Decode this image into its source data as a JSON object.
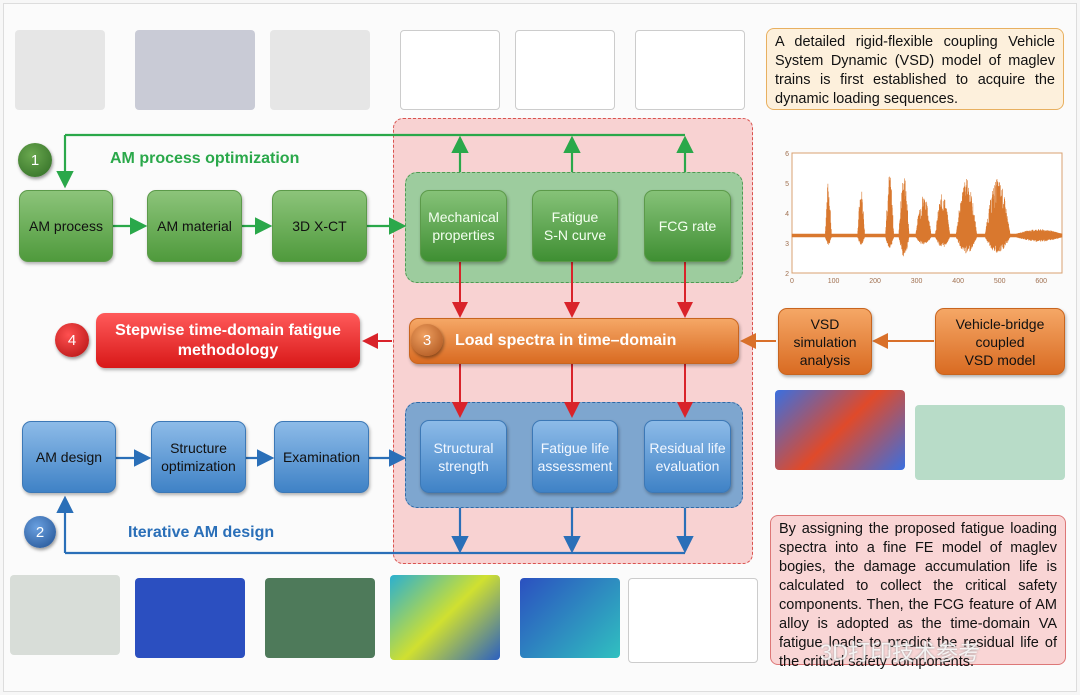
{
  "stage1": {
    "number": "1",
    "title": "AM process optimization",
    "boxes": [
      "AM process",
      "AM material",
      "3D X-CT"
    ],
    "properties": [
      {
        "line1": "Mechanical",
        "line2": "properties"
      },
      {
        "line1": "Fatigue",
        "line2": "S-N curve"
      },
      {
        "line1": "FCG rate",
        "line2": ""
      }
    ]
  },
  "stage2": {
    "number": "2",
    "title": "Iterative AM design",
    "boxes": [
      {
        "line1": "AM design",
        "line2": ""
      },
      {
        "line1": "Structure",
        "line2": "optimization"
      },
      {
        "line1": "Examination",
        "line2": ""
      }
    ],
    "evaluations": [
      {
        "line1": "Structural",
        "line2": "strength"
      },
      {
        "line1": "Fatigue life",
        "line2": "assessment"
      },
      {
        "line1": "Residual life",
        "line2": "evaluation"
      }
    ]
  },
  "stage3": {
    "number": "3",
    "title": "Load spectra in time–domain"
  },
  "stage4": {
    "number": "4",
    "title_line1": "Stepwise time-domain fatigue",
    "title_line2": "methodology"
  },
  "vsd": {
    "simulation_line1": "VSD simulation",
    "simulation_line2": "analysis",
    "model_line1": "Vehicle-bridge",
    "model_line2": "coupled",
    "model_line3": "VSD model"
  },
  "notes": {
    "top": "A detailed rigid-flexible coupling Vehicle System Dynamic (VSD) model of maglev trains is first established to acquire the dynamic loading sequences.",
    "bottom": "By assigning the proposed fatigue loading spectra into a fine FE model of maglev bogies, the damage accumulation life is calculated to collect the critical safety components. Then, the FCG feature of AM alloy is adopted as the time-domain VA fatigue loads to predict the residual life of the critical safety components."
  },
  "watermark": "3D打印技术参考",
  "colors": {
    "green": "#2aa84a",
    "blue": "#2a6fb8",
    "red": "#d9232a",
    "orange": "#d9702a",
    "signal": "#d9782e"
  },
  "chart_data": {
    "type": "line",
    "xlim": [
      0,
      650
    ],
    "ylim": [
      2,
      6
    ],
    "xticks": [
      0,
      100,
      200,
      300,
      400,
      500,
      600
    ],
    "yticks": [
      2,
      3,
      4,
      5,
      6
    ],
    "baseline": 3.25,
    "bursts": [
      {
        "x": [
          80,
          95
        ],
        "max": 5.0,
        "min": 3.0
      },
      {
        "x": [
          158,
          175
        ],
        "max": 4.8,
        "min": 3.0
      },
      {
        "x": [
          225,
          245
        ],
        "max": 5.3,
        "min": 2.9
      },
      {
        "x": [
          257,
          282
        ],
        "max": 5.2,
        "min": 2.6
      },
      {
        "x": [
          298,
          335
        ],
        "max": 4.6,
        "min": 3.0
      },
      {
        "x": [
          345,
          380
        ],
        "max": 4.6,
        "min": 2.9
      },
      {
        "x": [
          395,
          445
        ],
        "max": 5.1,
        "min": 2.7
      },
      {
        "x": [
          465,
          525
        ],
        "max": 5.1,
        "min": 2.7
      },
      {
        "x": [
          540,
          650
        ],
        "max": 3.4,
        "min": 3.1
      }
    ]
  }
}
